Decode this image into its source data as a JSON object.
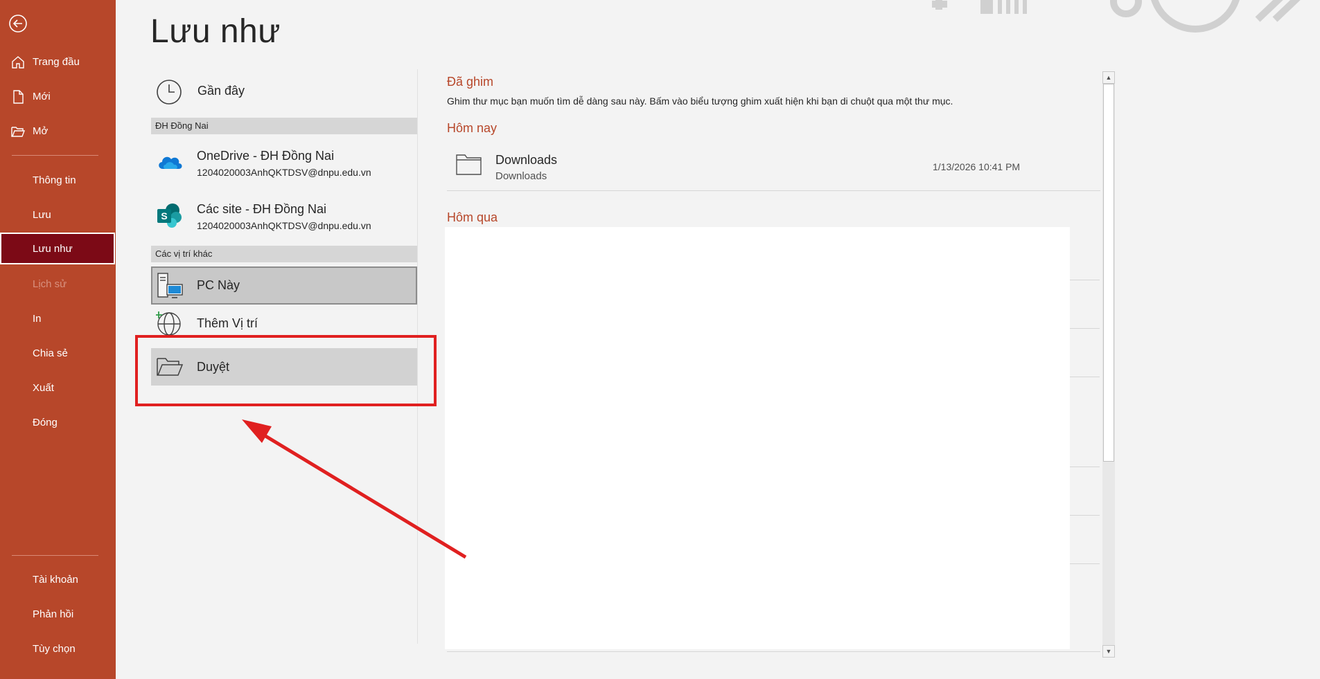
{
  "sidebar": {
    "items": [
      {
        "label": "Trang đầu"
      },
      {
        "label": "Mới"
      },
      {
        "label": "Mở"
      },
      {
        "label": "Thông tin"
      },
      {
        "label": "Lưu"
      },
      {
        "label": "Lưu như"
      },
      {
        "label": "Lịch sử"
      },
      {
        "label": "In"
      },
      {
        "label": "Chia sẻ"
      },
      {
        "label": "Xuất"
      },
      {
        "label": "Đóng"
      },
      {
        "label": "Tài khoản"
      },
      {
        "label": "Phản hồi"
      },
      {
        "label": "Tùy chọn"
      }
    ],
    "active": "Lưu như",
    "disabled": [
      "Lịch sử"
    ]
  },
  "page": {
    "title": "Lưu như"
  },
  "locations": {
    "recent": {
      "label": "Gần đây"
    },
    "group1": {
      "label": "ĐH Đồng Nai"
    },
    "onedrive": {
      "name": "OneDrive - ĐH Đồng Nai",
      "email": "1204020003AnhQKTDSV@dnpu.edu.vn"
    },
    "sites": {
      "name": "Các site - ĐH Đồng Nai",
      "email": "1204020003AnhQKTDSV@dnpu.edu.vn"
    },
    "group2": {
      "label": "Các vị trí khác"
    },
    "this_pc": {
      "name": "PC Này"
    },
    "add_place": {
      "name": "Thêm Vị trí"
    },
    "browse": {
      "name": "Duyệt"
    }
  },
  "right": {
    "pinned": {
      "heading": "Đã ghim",
      "description": "Ghim thư mục bạn muốn tìm dễ dàng sau này. Bấm vào biểu tượng ghim xuất hiện khi bạn di chuột qua một thư mục."
    },
    "today": {
      "heading": "Hôm nay",
      "folders": [
        {
          "name": "Downloads",
          "path": "Downloads",
          "date": "1/13/2026 10:41 PM"
        }
      ]
    },
    "yesterday": {
      "heading": "Hôm qua"
    }
  },
  "colors": {
    "accent": "#b7472a",
    "sidebar_active": "#7c0a16",
    "annotation": "#e02020"
  }
}
